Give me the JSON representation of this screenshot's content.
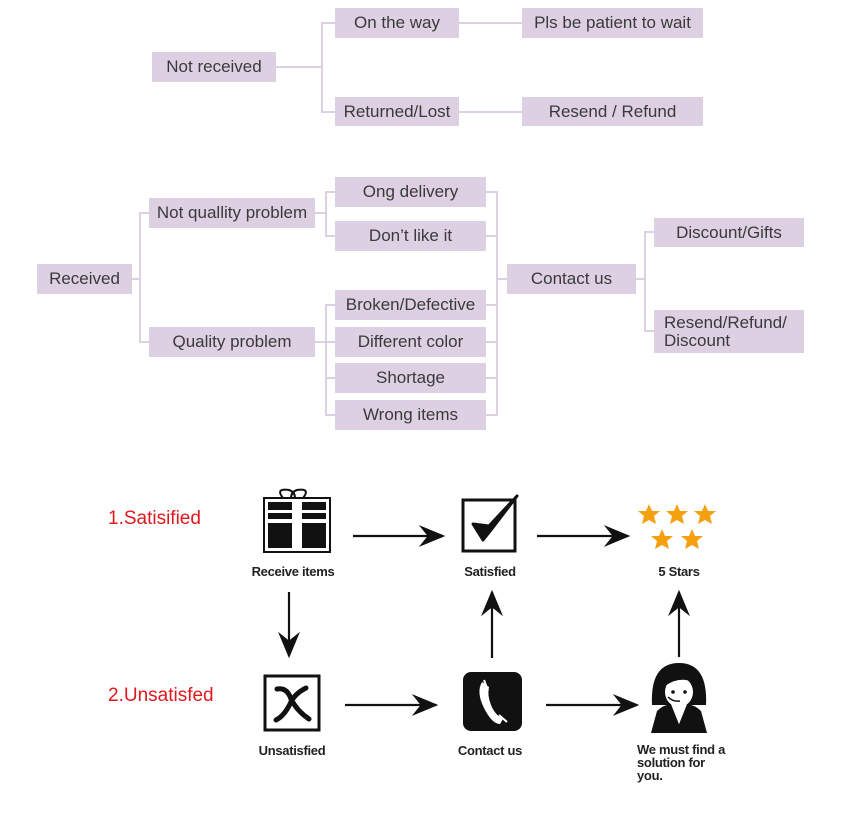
{
  "tree1": {
    "root": "Not received",
    "branches": [
      "On the way",
      "Returned/Lost"
    ],
    "outcomes": [
      "Pls be patient to wait",
      "Resend / Refund"
    ]
  },
  "tree2": {
    "root": "Received",
    "categories": [
      "Not quallity problem",
      "Quality problem"
    ],
    "not_quality_items": [
      "Ong delivery",
      "Don’t like it"
    ],
    "quality_items": [
      "Broken/Defective",
      "Different color",
      "Shortage",
      "Wrong items"
    ],
    "contact": "Contact us",
    "results": [
      "Discount/Gifts",
      "Resend/Refund/ Discount"
    ]
  },
  "flow": {
    "row1_label": "1.Satisified",
    "row2_label": "2.Unsatisfed",
    "nodes": {
      "receive": "Receive items",
      "satisfied": "Satisfied",
      "stars": "5 Stars",
      "unsatisfied": "Unsatisfied",
      "contact": "Contact us",
      "solution": "We must find a solution for you."
    },
    "colors": {
      "box": "#ddd0e2",
      "accent_red": "#e0191e",
      "star": "#f5a00f"
    },
    "stars_count": 5
  }
}
